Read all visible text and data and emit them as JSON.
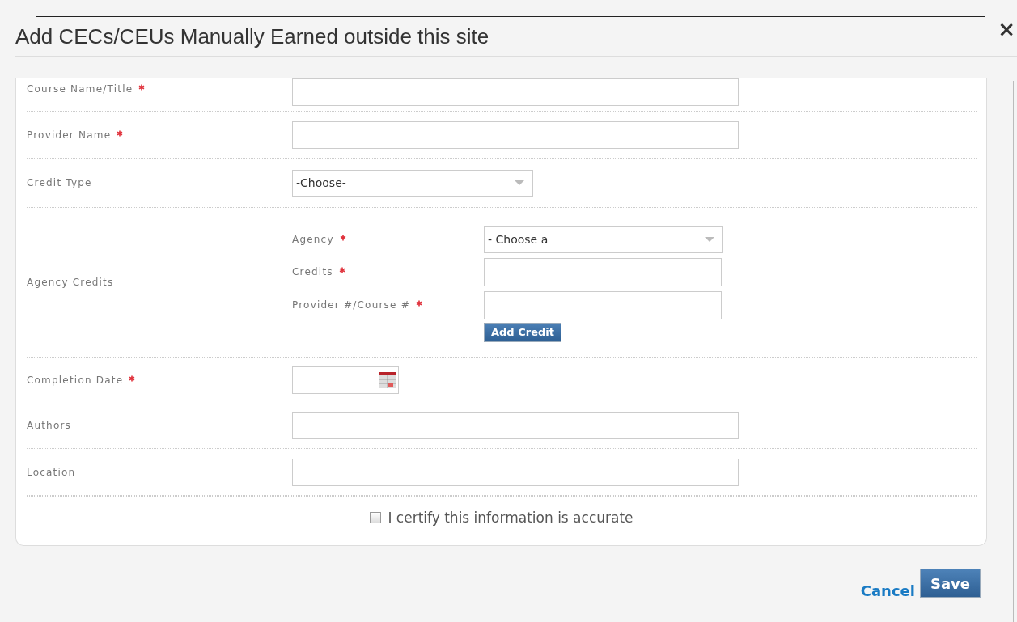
{
  "dialog": {
    "title": "Add CECs/CEUs Manually Earned outside this site",
    "close": "×"
  },
  "fields": [
    {
      "kind": "text",
      "label": "Course Name/Title",
      "required": true
    },
    {
      "kind": "text",
      "label": "Provider Name",
      "required": true
    },
    {
      "kind": "select",
      "label": "Credit Type",
      "required": false,
      "value": "-Choose-"
    },
    {
      "kind": "group",
      "label": "Agency Credits",
      "required": false,
      "subfields": [
        {
          "kind": "select",
          "label": "Agency",
          "required": true,
          "value": "- Choose a"
        },
        {
          "kind": "text",
          "label": "Credits",
          "required": true
        },
        {
          "kind": "text",
          "label": "Provider #/Course #",
          "required": true
        }
      ],
      "button": "Add Credit"
    },
    {
      "kind": "date",
      "label": "Completion Date",
      "required": true
    },
    {
      "kind": "text",
      "label": "Authors",
      "required": false
    },
    {
      "kind": "text",
      "label": "Location",
      "required": false
    }
  ],
  "certify": {
    "label": "I certify this information is accurate",
    "checked": false
  },
  "actions": {
    "cancel": "Cancel",
    "save": "Save"
  }
}
